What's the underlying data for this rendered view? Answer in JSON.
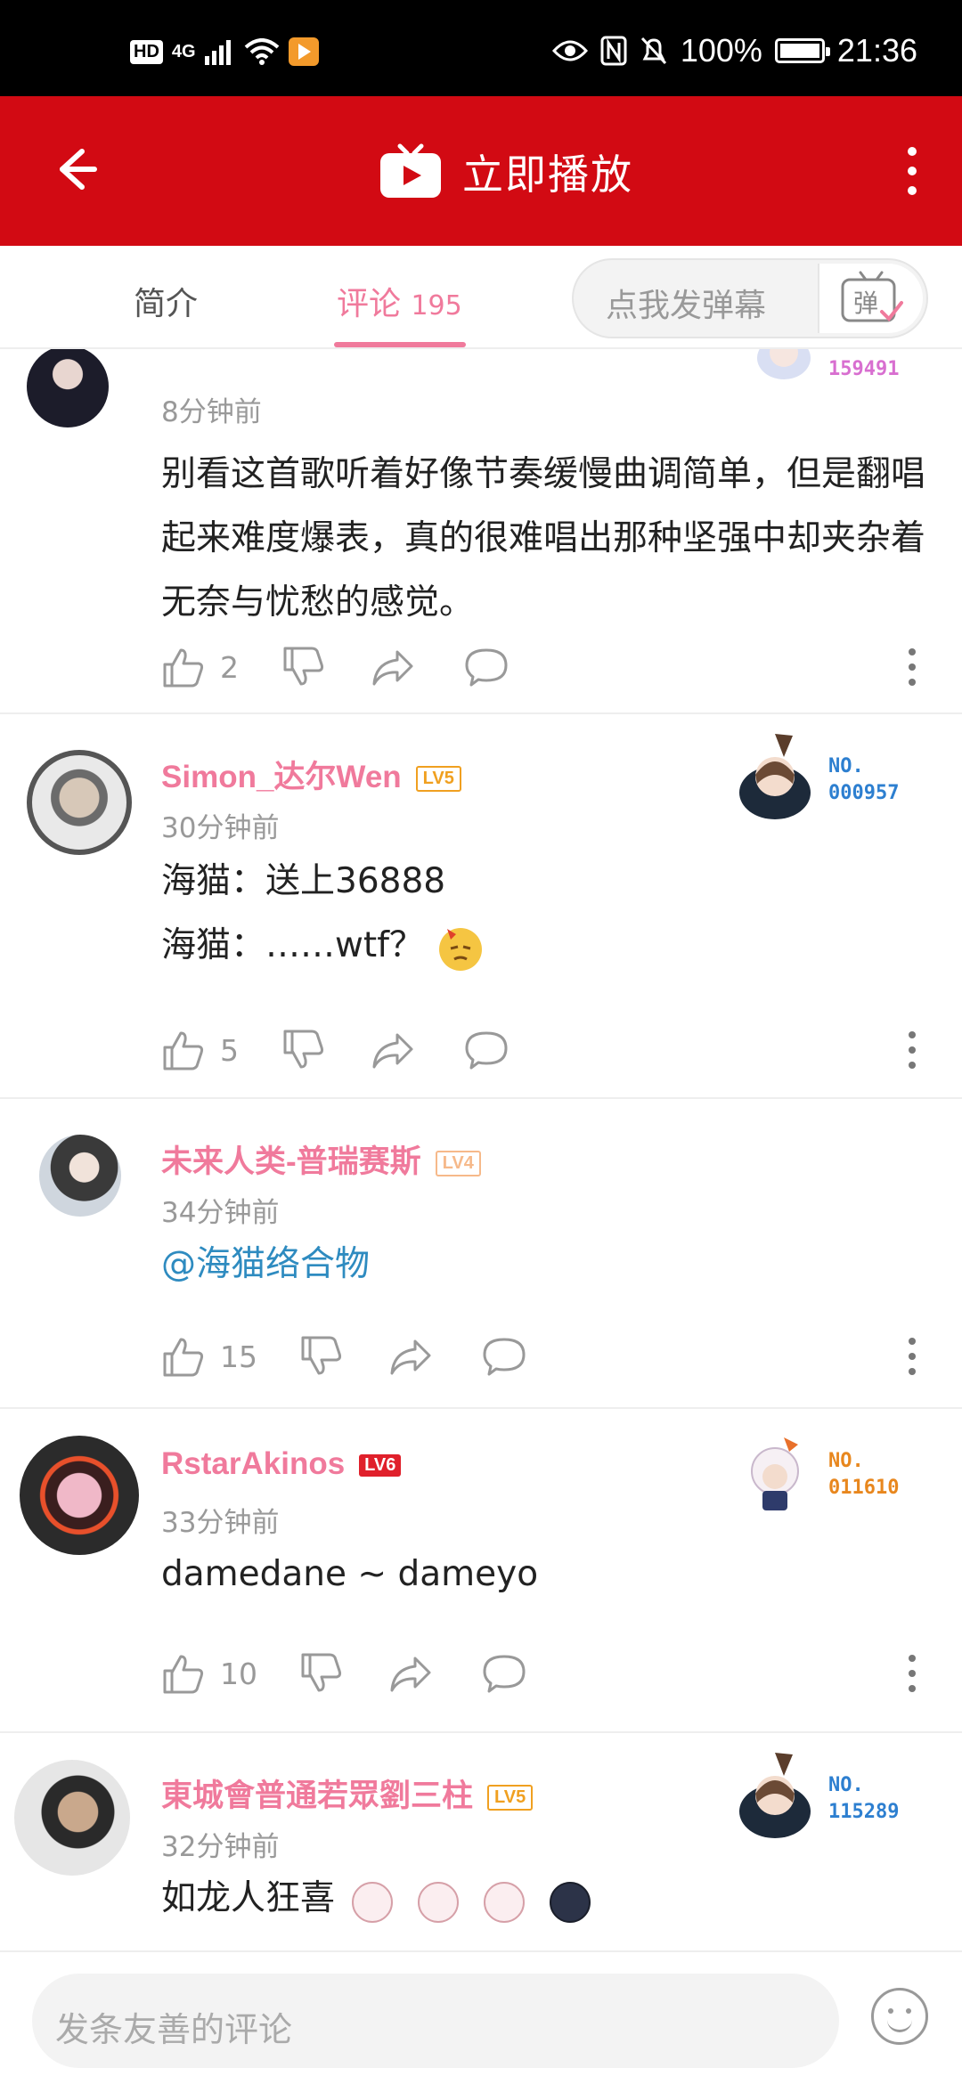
{
  "status_bar": {
    "hd": "HD",
    "network": "4G",
    "battery_pct": "100%",
    "time": "21:36"
  },
  "header": {
    "title": "立即播放"
  },
  "tabs": {
    "intro": "简介",
    "comments": "评论",
    "comment_count": "195",
    "danmu_placeholder": "点我发弹幕",
    "danmu_button": "弹"
  },
  "comments": [
    {
      "username": "",
      "level": "",
      "time": "8分钟前",
      "content": "别看这首歌听着好像节奏缓慢曲调简单，但是翻唱起来难度爆表，真的很难唱出那种坚强中却夹杂着无奈与忧愁的感觉。",
      "likes": "2",
      "fan_no": "159491",
      "fan_color": "#d86fd0"
    },
    {
      "username": "Simon_达尔Wen",
      "level": "LV5",
      "time": "30分钟前",
      "content_line1": "海猫：送上36888",
      "content_line2": "海猫：……wtf？",
      "likes": "5",
      "fan_label": "NO.",
      "fan_no": "000957",
      "fan_color": "#2d7fd0"
    },
    {
      "username": "未来人类-普瑞赛斯",
      "level": "LV4",
      "time": "34分钟前",
      "content": "@海猫络合物",
      "likes": "15"
    },
    {
      "username": "RstarAkinos",
      "level": "LV6",
      "time": "33分钟前",
      "content": "damedane ~ dameyo",
      "likes": "10",
      "fan_label": "NO.",
      "fan_no": "011610",
      "fan_color": "#e8871e"
    },
    {
      "username": "東城會普通若眾劉三柱",
      "level": "LV5",
      "time": "32分钟前",
      "content": "如龙人狂喜",
      "fan_label": "NO.",
      "fan_no": "115289",
      "fan_color": "#2d7fd0"
    }
  ],
  "bottom": {
    "input_placeholder": "发条友善的评论"
  },
  "colors": {
    "header_red": "#d20a13",
    "accent_pink": "#f07a9c",
    "link_blue": "#2e8bc0",
    "lv5_orange": "#f0a020",
    "lv4_peach": "#f6b98a",
    "lv6_red": "#e0202b"
  }
}
